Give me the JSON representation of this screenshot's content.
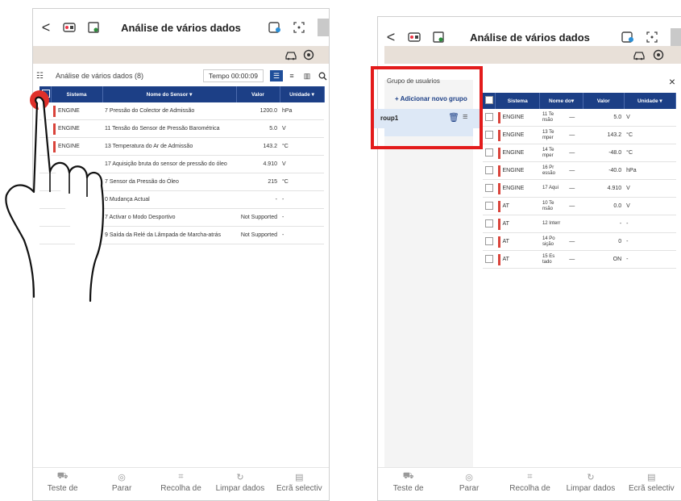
{
  "left": {
    "title": "Análise de vários dados",
    "back": "<",
    "subbar_label": "Análise de vários dados (8)",
    "timer": "Tempo 00:00:09",
    "columns": [
      "Sistema",
      "Nome do Sensor",
      "Valor",
      "Unidade"
    ],
    "rows": [
      {
        "sistema": "ENGINE",
        "sensor": "7 Pressão do Colector de Admissão",
        "valor": "1200.0",
        "unidade": "hPa"
      },
      {
        "sistema": "ENGINE",
        "sensor": "11 Tensão do Sensor de Pressão Barométrica",
        "valor": "5.0",
        "unidade": "V"
      },
      {
        "sistema": "ENGINE",
        "sensor": "13 Temperatura do Ar de Admissão",
        "valor": "143.2",
        "unidade": "°C"
      },
      {
        "sistema": "",
        "sensor": "17 Aquisição bruta do sensor de pressão do óleo",
        "valor": "4.910",
        "unidade": "V"
      },
      {
        "sistema": "",
        "sensor": "7 Sensor da Pressão do Óleo",
        "valor": "215",
        "unidade": "°C"
      },
      {
        "sistema": "",
        "sensor": "0 Mudança Actual",
        "valor": "-",
        "unidade": "-"
      },
      {
        "sistema": "",
        "sensor": "7 Activar o Modo Desportivo",
        "valor": "Not Supported",
        "unidade": "-"
      },
      {
        "sistema": "",
        "sensor": "9 Saída da Relé da Lâmpada de Marcha-atrás",
        "valor": "Not Supported",
        "unidade": "-"
      }
    ],
    "nav": [
      "Teste de",
      "Parar",
      "Recolha de",
      "Limpar dados",
      "Ecrã selectiv"
    ]
  },
  "right": {
    "title": "Análise de vários dados",
    "back": "<",
    "group_header": "Grupo de usuários",
    "add_group": "+ Adicionar novo grupo",
    "group_name": "roup1",
    "close": "×",
    "columns": [
      "Sistema",
      "Nome do",
      "Valor",
      "Unidade"
    ],
    "rows": [
      {
        "sistema": "ENGINE",
        "sensor": "11 Te nsão",
        "dash": "—",
        "valor": "5.0",
        "unidade": "V"
      },
      {
        "sistema": "ENGINE",
        "sensor": "13 Te mper",
        "dash": "—",
        "valor": "143.2",
        "unidade": "°C"
      },
      {
        "sistema": "ENGINE",
        "sensor": "14 Te mper",
        "dash": "—",
        "valor": "-48.0",
        "unidade": "°C"
      },
      {
        "sistema": "ENGINE",
        "sensor": "16 Pr essão",
        "dash": "—",
        "valor": "-40.0",
        "unidade": "hPa"
      },
      {
        "sistema": "ENGINE",
        "sensor": "17 Aqui",
        "dash": "—",
        "valor": "4.910",
        "unidade": "V"
      },
      {
        "sistema": "AT",
        "sensor": "10 Te nsão",
        "dash": "—",
        "valor": "0.0",
        "unidade": "V"
      },
      {
        "sistema": "AT",
        "sensor": "12 Interr",
        "dash": "",
        "valor": "-",
        "unidade": "-"
      },
      {
        "sistema": "AT",
        "sensor": "14 Po sição",
        "dash": "—",
        "valor": "0",
        "unidade": "-"
      },
      {
        "sistema": "AT",
        "sensor": "15 Es tado",
        "dash": "—",
        "valor": "ON",
        "unidade": "-"
      }
    ],
    "nav": [
      "Teste de",
      "Parar",
      "Recolha de",
      "Limpar dados",
      "Ecrã selectiv"
    ]
  },
  "colors": {
    "header_blue": "#1c3f86",
    "beige": "#e8e0d8",
    "system_red": "#d9433a",
    "highlight_red": "#e31b1b",
    "touch_red": "#e0302a"
  }
}
